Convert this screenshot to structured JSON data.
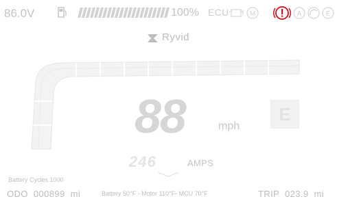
{
  "status": {
    "voltage": "86.0V",
    "battery_percent": "100%",
    "battery_level": 1.0,
    "ecu_label": "ECU",
    "alert_icon_color": "#d0121b"
  },
  "brand": {
    "name": "Ryvid"
  },
  "speed": {
    "value": "88",
    "unit": "mph"
  },
  "gear": {
    "letter": "E"
  },
  "current": {
    "value": "246",
    "unit": "AMPS"
  },
  "stats": {
    "battery_cycles": "Battery Cycles 1000",
    "odo": "ODO  000899  mi",
    "temps": "Battery 50°F - Motor 110°F- MCU 70°F",
    "trip": "TRIP  023.9  mi"
  },
  "icons": [
    "fuel-icon",
    "engine-icon",
    "m-mode-icon",
    "alert-icon",
    "a-mode-icon",
    "cruise-icon",
    "e-mode-icon"
  ]
}
